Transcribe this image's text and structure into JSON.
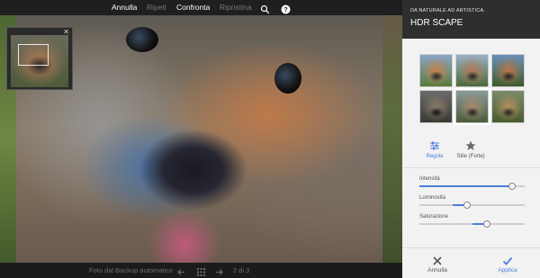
{
  "toolbar": {
    "undo_label": "Annulla",
    "redo_label": "Ripeti",
    "compare_label": "Confronta",
    "restore_label": "Ripristina",
    "search_icon": "search-icon",
    "help_icon": "help-icon"
  },
  "preview": {
    "close_glyph": "✕"
  },
  "bottombar": {
    "source_label": "Foto dal Backup automatico",
    "prev_icon": "arrow-left-icon",
    "grid_icon": "grid-icon",
    "next_icon": "arrow-right-icon",
    "counter": "2 di 3"
  },
  "panel": {
    "subtitle": "DA NATURALE AD ARTISTICA.",
    "title": "HDR SCAPE",
    "styles": [
      {
        "name": "style-1"
      },
      {
        "name": "style-2"
      },
      {
        "name": "style-3"
      },
      {
        "name": "style-4"
      },
      {
        "name": "style-5"
      },
      {
        "name": "style-6"
      }
    ],
    "tabs": [
      {
        "label": "Regola",
        "icon": "sliders-icon",
        "active": true
      },
      {
        "label": "Stile (Forte)",
        "icon": "star-icon",
        "active": false
      }
    ],
    "sliders": [
      {
        "label": "Intensità",
        "value": 0.88
      },
      {
        "label": "Luminosità",
        "value": 0.45
      },
      {
        "label": "Saturazione",
        "value": 0.64
      }
    ]
  },
  "actions": {
    "cancel_label": "Annulla",
    "apply_label": "Applica"
  },
  "colors": {
    "accent": "#4a7fd8",
    "panel_bg": "#f2f2f2",
    "header_bg": "#2e2e2e"
  }
}
